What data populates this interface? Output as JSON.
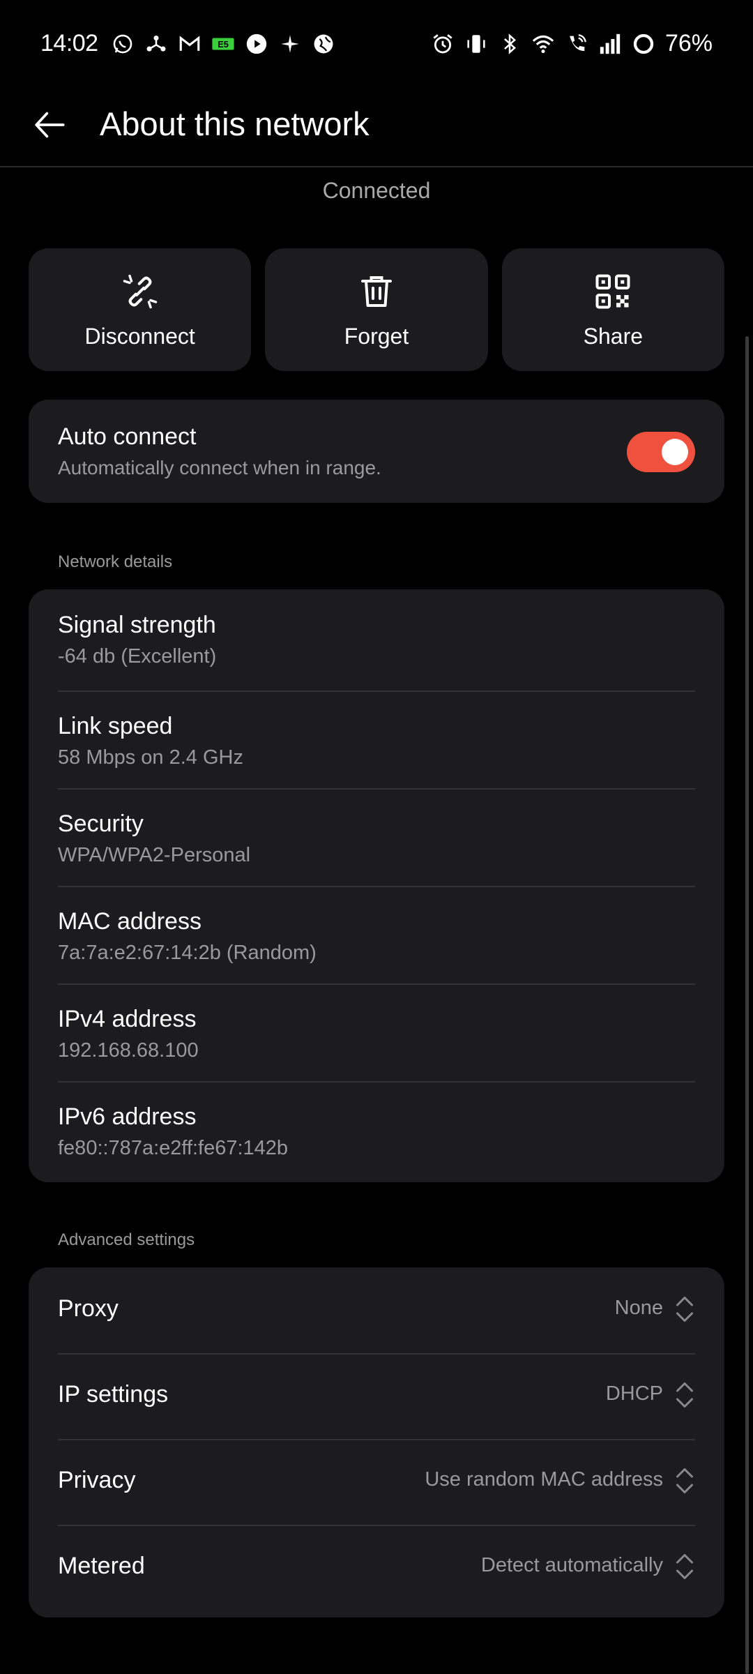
{
  "status_bar": {
    "time": "14:02",
    "battery": "76%",
    "left_icons": [
      "whatsapp-icon",
      "network-share-icon",
      "gmail-icon",
      "sim-badge-icon",
      "play-icon",
      "sparkle-icon",
      "globe-icon"
    ],
    "right_icons": [
      "alarm-icon",
      "vibrate-icon",
      "bluetooth-icon",
      "wifi-icon",
      "wifi-calling-icon",
      "signal-icon",
      "battery-ring-icon"
    ]
  },
  "header": {
    "title": "About this network",
    "back_icon": "arrow-left-icon"
  },
  "connection_status": "Connected",
  "actions": [
    {
      "label": "Disconnect",
      "icon": "unlink-icon"
    },
    {
      "label": "Forget",
      "icon": "trash-icon"
    },
    {
      "label": "Share",
      "icon": "qr-code-icon"
    }
  ],
  "auto_connect": {
    "title": "Auto connect",
    "subtitle": "Automatically connect when in range.",
    "enabled": true,
    "accent_color": "#f0513e"
  },
  "network_details": {
    "section_title": "Network details",
    "rows": [
      {
        "title": "Signal strength",
        "value": "-64 db (Excellent)"
      },
      {
        "title": "Link speed",
        "value": "58 Mbps on 2.4 GHz"
      },
      {
        "title": "Security",
        "value": "WPA/WPA2-Personal"
      },
      {
        "title": "MAC address",
        "value": "7a:7a:e2:67:14:2b (Random)"
      },
      {
        "title": "IPv4 address",
        "value": "192.168.68.100"
      },
      {
        "title": "IPv6 address",
        "value": "fe80::787a:e2ff:fe67:142b"
      }
    ]
  },
  "advanced_settings": {
    "section_title": "Advanced settings",
    "rows": [
      {
        "title": "Proxy",
        "value": "None"
      },
      {
        "title": "IP settings",
        "value": "DHCP"
      },
      {
        "title": "Privacy",
        "value": "Use random MAC address"
      },
      {
        "title": "Metered",
        "value": "Detect automatically"
      }
    ]
  }
}
